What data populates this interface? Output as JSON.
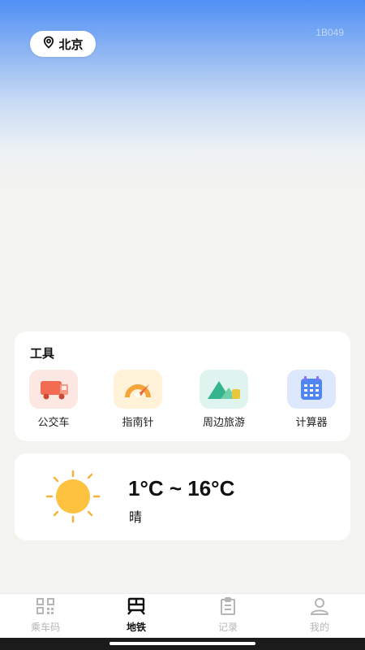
{
  "location": {
    "city": "北京"
  },
  "counter_text": "1B049",
  "tools": {
    "title": "工具",
    "items": [
      {
        "label": "公交车",
        "icon": "bus-icon",
        "color": "#f06b51"
      },
      {
        "label": "指南针",
        "icon": "compass-icon",
        "color": "#f3a53a"
      },
      {
        "label": "周边旅游",
        "icon": "mountain-icon",
        "color": "#35b58d"
      },
      {
        "label": "计算器",
        "icon": "calculator-icon",
        "color": "#4f86f2"
      }
    ]
  },
  "weather": {
    "temp_range": "1°C ~ 16°C",
    "condition": "晴",
    "icon": "sun-icon"
  },
  "tabbar": {
    "active": "地铁",
    "items": [
      {
        "label": "乘车码",
        "icon": "qrcode-icon"
      },
      {
        "label": "地铁",
        "icon": "subway-icon"
      },
      {
        "label": "记录",
        "icon": "clipboard-icon"
      },
      {
        "label": "我的",
        "icon": "user-icon"
      }
    ]
  }
}
